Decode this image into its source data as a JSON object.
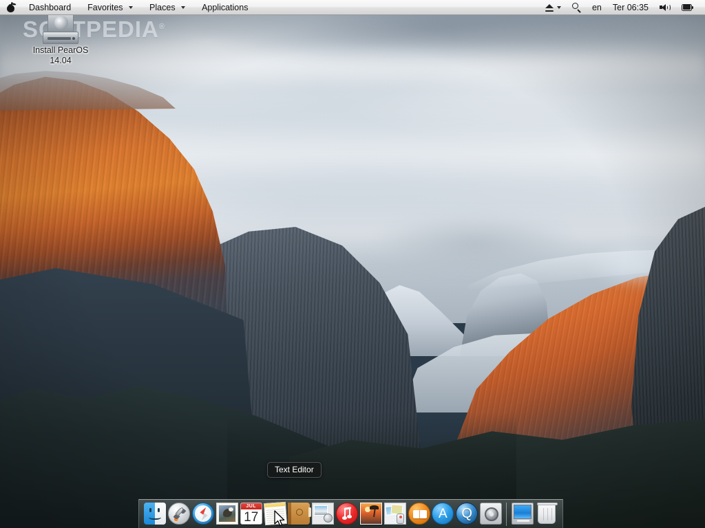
{
  "menubar": {
    "logo_icon": "pear-logo-icon",
    "items": [
      {
        "label": "Dashboard",
        "has_caret": false
      },
      {
        "label": "Favorites",
        "has_caret": true
      },
      {
        "label": "Places",
        "has_caret": true
      },
      {
        "label": "Applications",
        "has_caret": false
      }
    ],
    "status": {
      "eject_icon": "eject-icon",
      "eject_caret_icon": "chevron-down-icon",
      "search_icon": "search-icon",
      "keyboard_layout": "en",
      "clock": "Ter 06:35",
      "volume_icon": "volume-icon",
      "battery_icon": "battery-icon"
    }
  },
  "watermark": {
    "text": "SOFTPEDIA",
    "mark": "®"
  },
  "desktop": {
    "icon": {
      "name": "drive-icon",
      "label_line1": "Install PearOS",
      "label_line2": "14.04"
    }
  },
  "tooltip": {
    "text": "Text Editor"
  },
  "dock": {
    "items": [
      {
        "name": "finder",
        "label": "Finder",
        "icon": "finder-icon"
      },
      {
        "name": "launchpad",
        "label": "Launchpad",
        "icon": "launchpad-rocket-icon"
      },
      {
        "name": "safari",
        "label": "Safari",
        "icon": "safari-compass-icon"
      },
      {
        "name": "mail",
        "label": "Mail",
        "icon": "mail-stamp-icon"
      },
      {
        "name": "calendar",
        "label": "Calendar",
        "icon": "calendar-icon",
        "month": "JUL",
        "day": "17"
      },
      {
        "name": "text-editor",
        "label": "Text Editor",
        "icon": "notes-icon"
      },
      {
        "name": "contacts",
        "label": "Contacts",
        "icon": "address-book-icon"
      },
      {
        "name": "image-capture",
        "label": "Image Capture",
        "icon": "image-capture-icon"
      },
      {
        "name": "itunes",
        "label": "iTunes",
        "icon": "itunes-note-icon"
      },
      {
        "name": "iphoto",
        "label": "iPhoto",
        "icon": "iphoto-icon"
      },
      {
        "name": "preview",
        "label": "Preview",
        "icon": "preview-icon"
      },
      {
        "name": "ibooks",
        "label": "iBooks",
        "icon": "ibooks-icon"
      },
      {
        "name": "app-store",
        "label": "App Store",
        "icon": "app-store-icon",
        "glyph": "A"
      },
      {
        "name": "quicktime",
        "label": "QuickTime Player",
        "icon": "quicktime-icon",
        "glyph": "Q"
      },
      {
        "name": "system-preferences",
        "label": "System Preferences",
        "icon": "gear-icon"
      }
    ],
    "right_items": [
      {
        "name": "displays",
        "label": "Displays",
        "icon": "display-window-icon"
      },
      {
        "name": "trash",
        "label": "Trash",
        "icon": "trash-icon"
      }
    ]
  },
  "colors": {
    "menubar_text": "#131313",
    "calendar_header": "#c4281f",
    "accent_blue": "#1b87d6",
    "tooltip_bg": "rgba(22,22,22,.72)"
  }
}
